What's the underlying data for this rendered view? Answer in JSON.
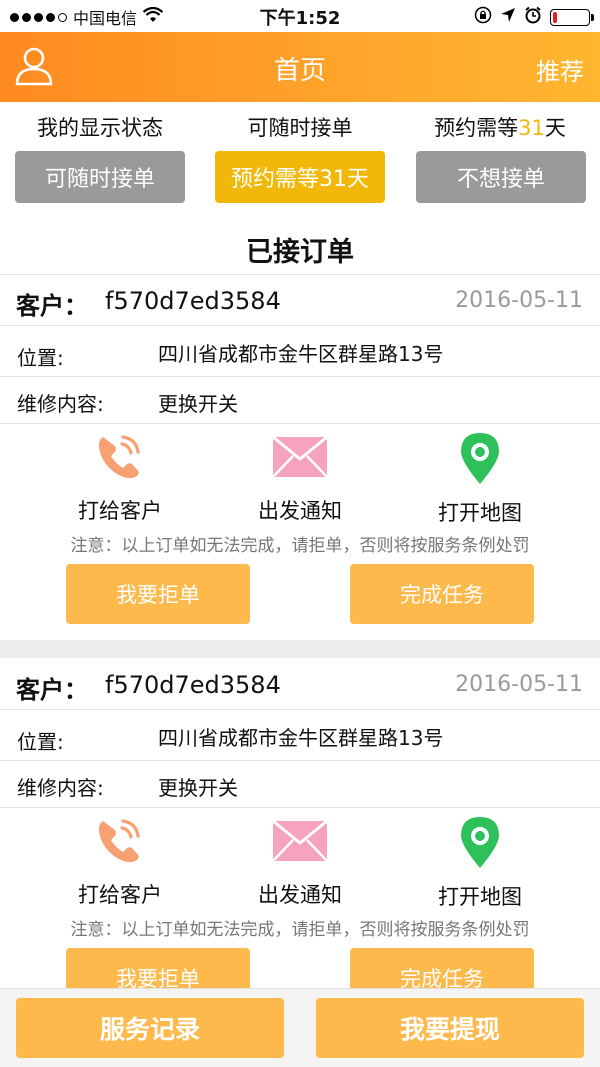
{
  "status_bar": {
    "carrier": "中国电信",
    "time": "下午1:52",
    "signal_dots_filled": 4,
    "signal_dots_total": 5,
    "battery_level": 0.12,
    "icons": [
      "wifi-icon",
      "orientation-lock-icon",
      "location-icon",
      "alarm-icon",
      "battery-icon"
    ]
  },
  "navbar": {
    "title": "首页",
    "right_label": "推荐",
    "left_icon": "user-icon",
    "colors": {
      "start": "#ff8a1f",
      "end": "#ffb630"
    }
  },
  "display_status": {
    "label_mine": "我的显示状态",
    "label_available": "可随时接单",
    "label_reserve_prefix": "预约需等",
    "label_reserve_days": "31",
    "label_reserve_suffix": "天",
    "buttons": [
      {
        "label": "可随时接单",
        "color": "#9a9a9a",
        "selected": false
      },
      {
        "label": "预约需等31天",
        "color": "#f1b80a",
        "selected": true
      },
      {
        "label": "不想接单",
        "color": "#9a9a9a",
        "selected": false
      }
    ]
  },
  "section_title": "已接订单",
  "orders": [
    {
      "customer_label": "客户：",
      "customer_id": "f570d7ed3584",
      "date": "2016-05-11",
      "location_label": "位置:",
      "location": "四川省成都市金牛区群星路13号",
      "repair_label": "维修内容:",
      "repair": "更换开关",
      "actions": [
        {
          "label": "打给客户",
          "icon": "phone-icon"
        },
        {
          "label": "出发通知",
          "icon": "mail-icon"
        },
        {
          "label": "打开地图",
          "icon": "map-pin-icon"
        }
      ],
      "notice": "注意：以上订单如无法完成，请拒单，否则将按服务条例处罚",
      "reject_label": "我要拒单",
      "complete_label": "完成任务"
    },
    {
      "customer_label": "客户：",
      "customer_id": "f570d7ed3584",
      "date": "2016-05-11",
      "location_label": "位置:",
      "location": "四川省成都市金牛区群星路13号",
      "repair_label": "维修内容:",
      "repair": "更换开关",
      "actions": [
        {
          "label": "打给客户",
          "icon": "phone-icon"
        },
        {
          "label": "出发通知",
          "icon": "mail-icon"
        },
        {
          "label": "打开地图",
          "icon": "map-pin-icon"
        }
      ],
      "notice": "注意：以上订单如无法完成，请拒单，否则将按服务条例处罚",
      "reject_label": "我要拒单",
      "complete_label": "完成任务"
    }
  ],
  "bottom_bar": {
    "service_record_label": "服务记录",
    "withdraw_label": "我要提现"
  },
  "colors": {
    "button_orange": "#fdb94c",
    "accent_yellow": "#f1b80a",
    "phone_icon": "#f7a071",
    "mail_icon": "#f6a3c0",
    "map_icon": "#2ec15a"
  }
}
